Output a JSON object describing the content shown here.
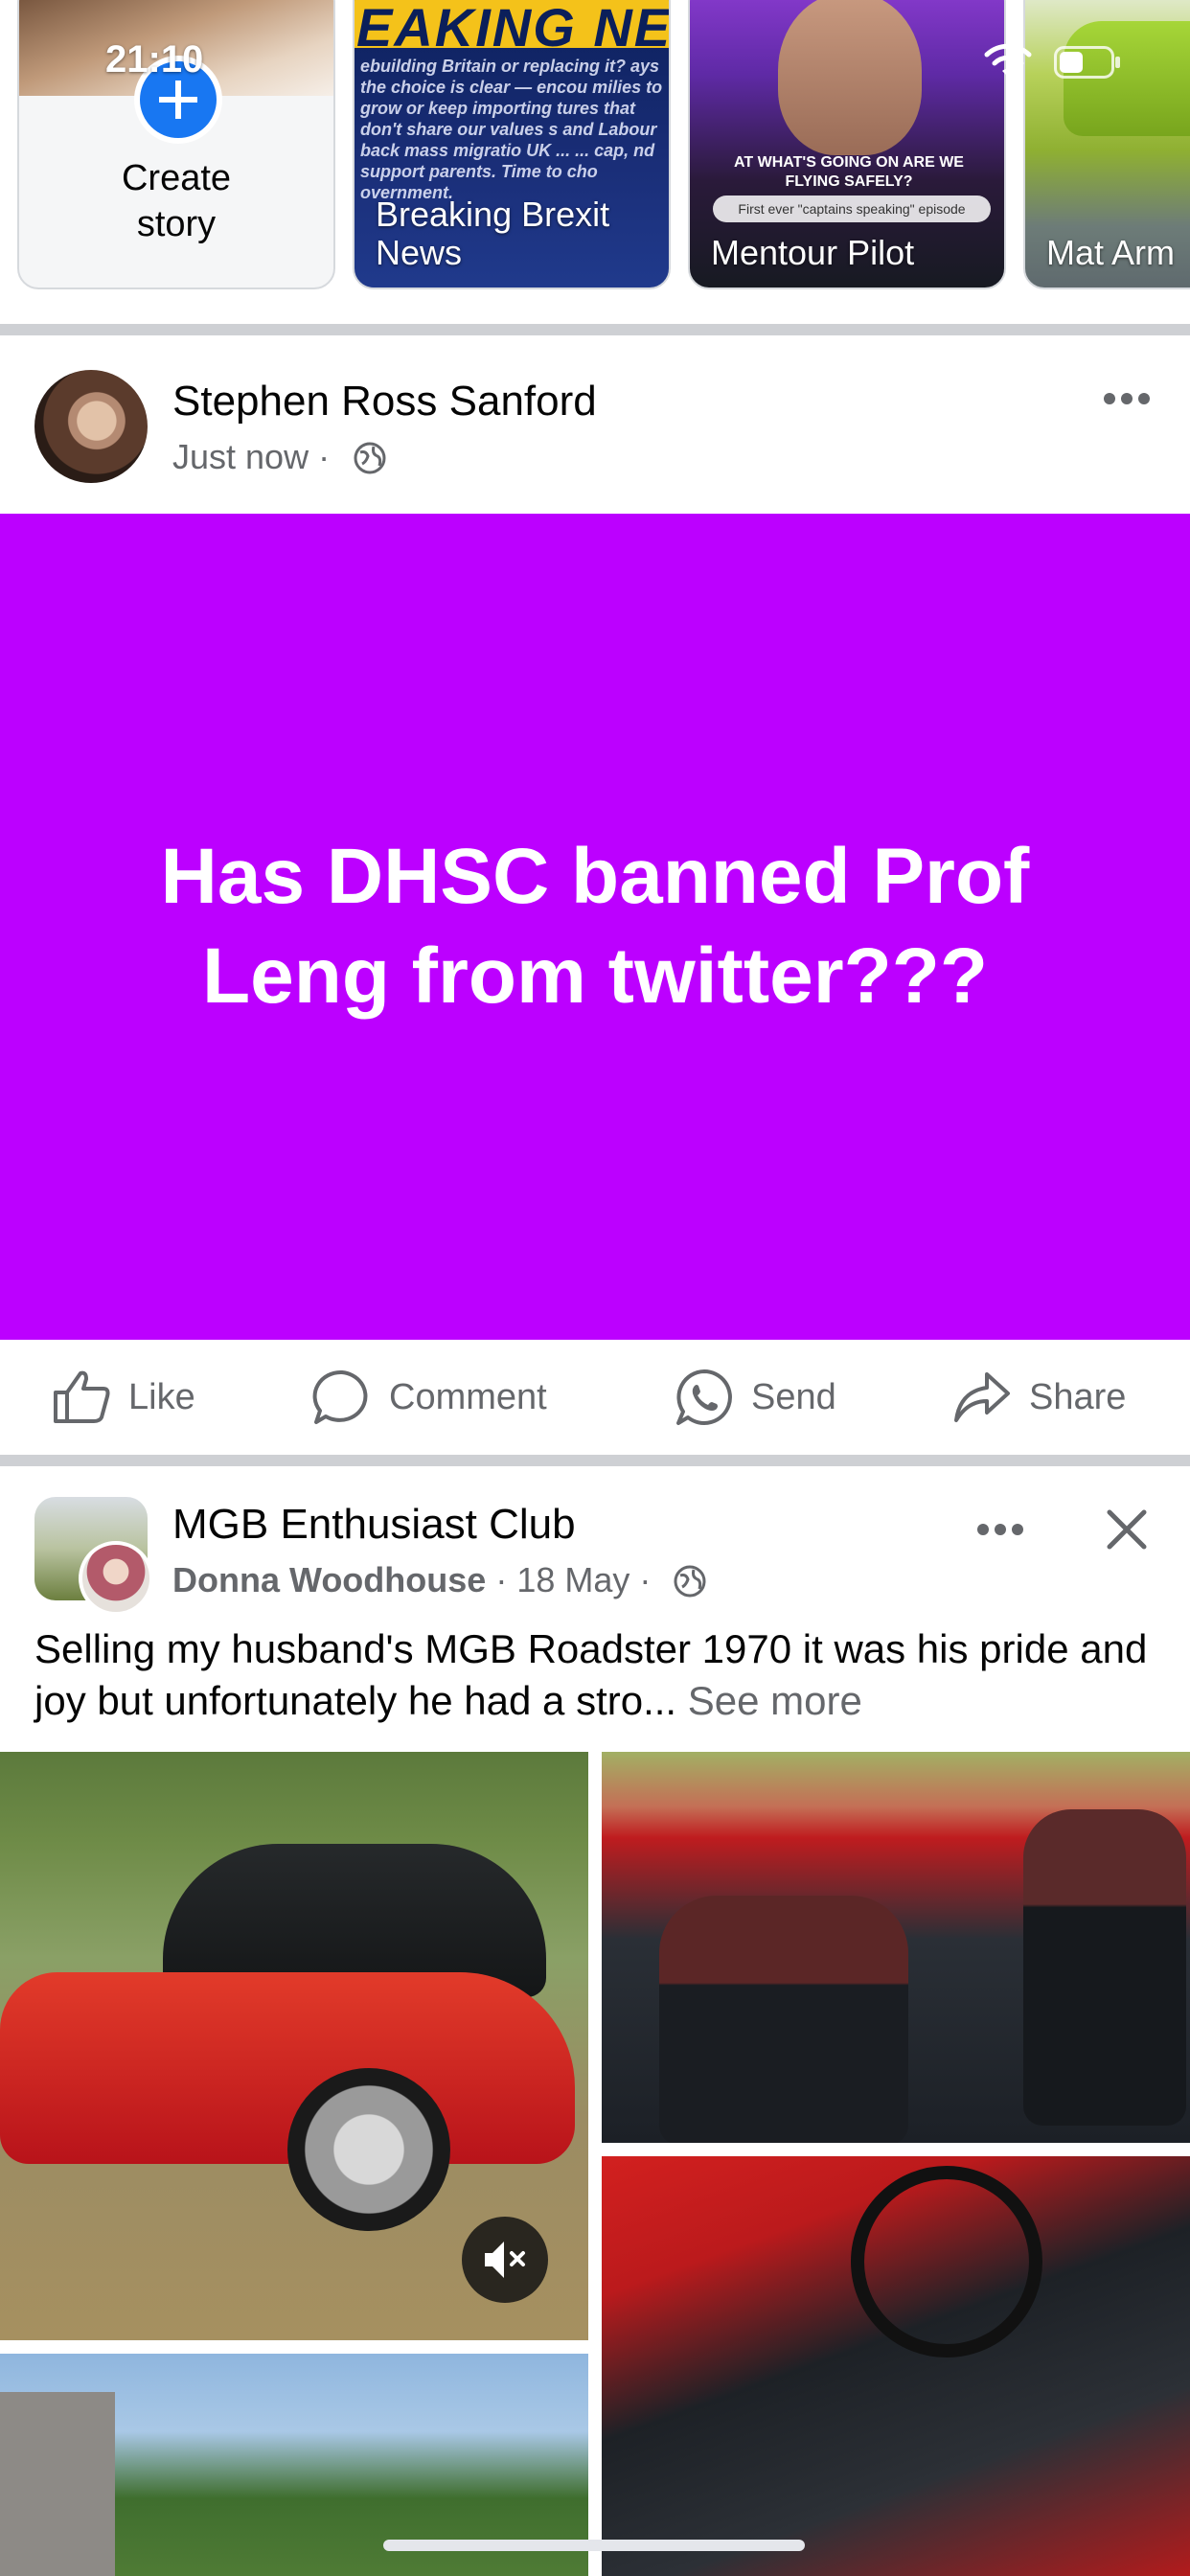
{
  "status_bar": {
    "time": "21:10"
  },
  "stories": [
    {
      "label": "Create\nstory"
    },
    {
      "name": "Breaking Brexit News",
      "headline": "EAKING NE",
      "body": "ebuilding Britain or replacing it? ays the choice is clear — encou milies to grow or keep importing tures that don't share our values s and Labour back mass migratio UK ... ... cap, nd support parents. Time to cho overnment."
    },
    {
      "name": "Mentour Pilot",
      "caption": "AT WHAT'S GOING ON ARE WE FLYING SAFELY?",
      "tag": "First ever \"captains speaking\" episode"
    },
    {
      "name": "Mat Arm"
    }
  ],
  "post1": {
    "author": "Stephen Ross Sanford",
    "time": "Just now",
    "card_text": "Has DHSC banned Prof Leng from twitter???",
    "card_color": "#bc00ff"
  },
  "actions": {
    "like": "Like",
    "comment": "Comment",
    "send": "Send",
    "share": "Share"
  },
  "post2": {
    "group": "MGB Enthusiast Club",
    "author": "Donna Woodhouse",
    "date": "18 May",
    "text": "Selling my husband's  MGB Roadster 1970 it was his pride and joy but unfortunately he had a stro...",
    "see_more": "See more"
  },
  "colors": {
    "brand_blue": "#1877f2",
    "secondary_text": "#65676b",
    "divider": "#ced0d4"
  }
}
